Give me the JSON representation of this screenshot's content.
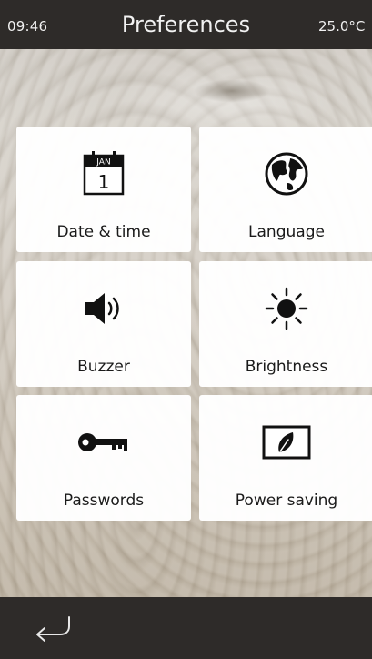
{
  "status_bar": {
    "time": "09:46",
    "title": "Preferences",
    "temperature": "25.0°C"
  },
  "tiles": [
    {
      "label": "Date & time",
      "icon": "calendar-icon",
      "calendar_month": "JAN",
      "calendar_day": "1"
    },
    {
      "label": "Language",
      "icon": "globe-icon"
    },
    {
      "label": "Buzzer",
      "icon": "speaker-icon"
    },
    {
      "label": "Brightness",
      "icon": "sun-icon"
    },
    {
      "label": "Passwords",
      "icon": "key-icon"
    },
    {
      "label": "Power saving",
      "icon": "leaf-icon"
    }
  ],
  "bottom_bar": {
    "back_icon": "back-arrow-icon"
  },
  "colors": {
    "bar_background": "#2e2b29",
    "tile_background": "#ffffff",
    "text_dark": "#1a1a1a",
    "text_light": "#f2f2f2"
  }
}
